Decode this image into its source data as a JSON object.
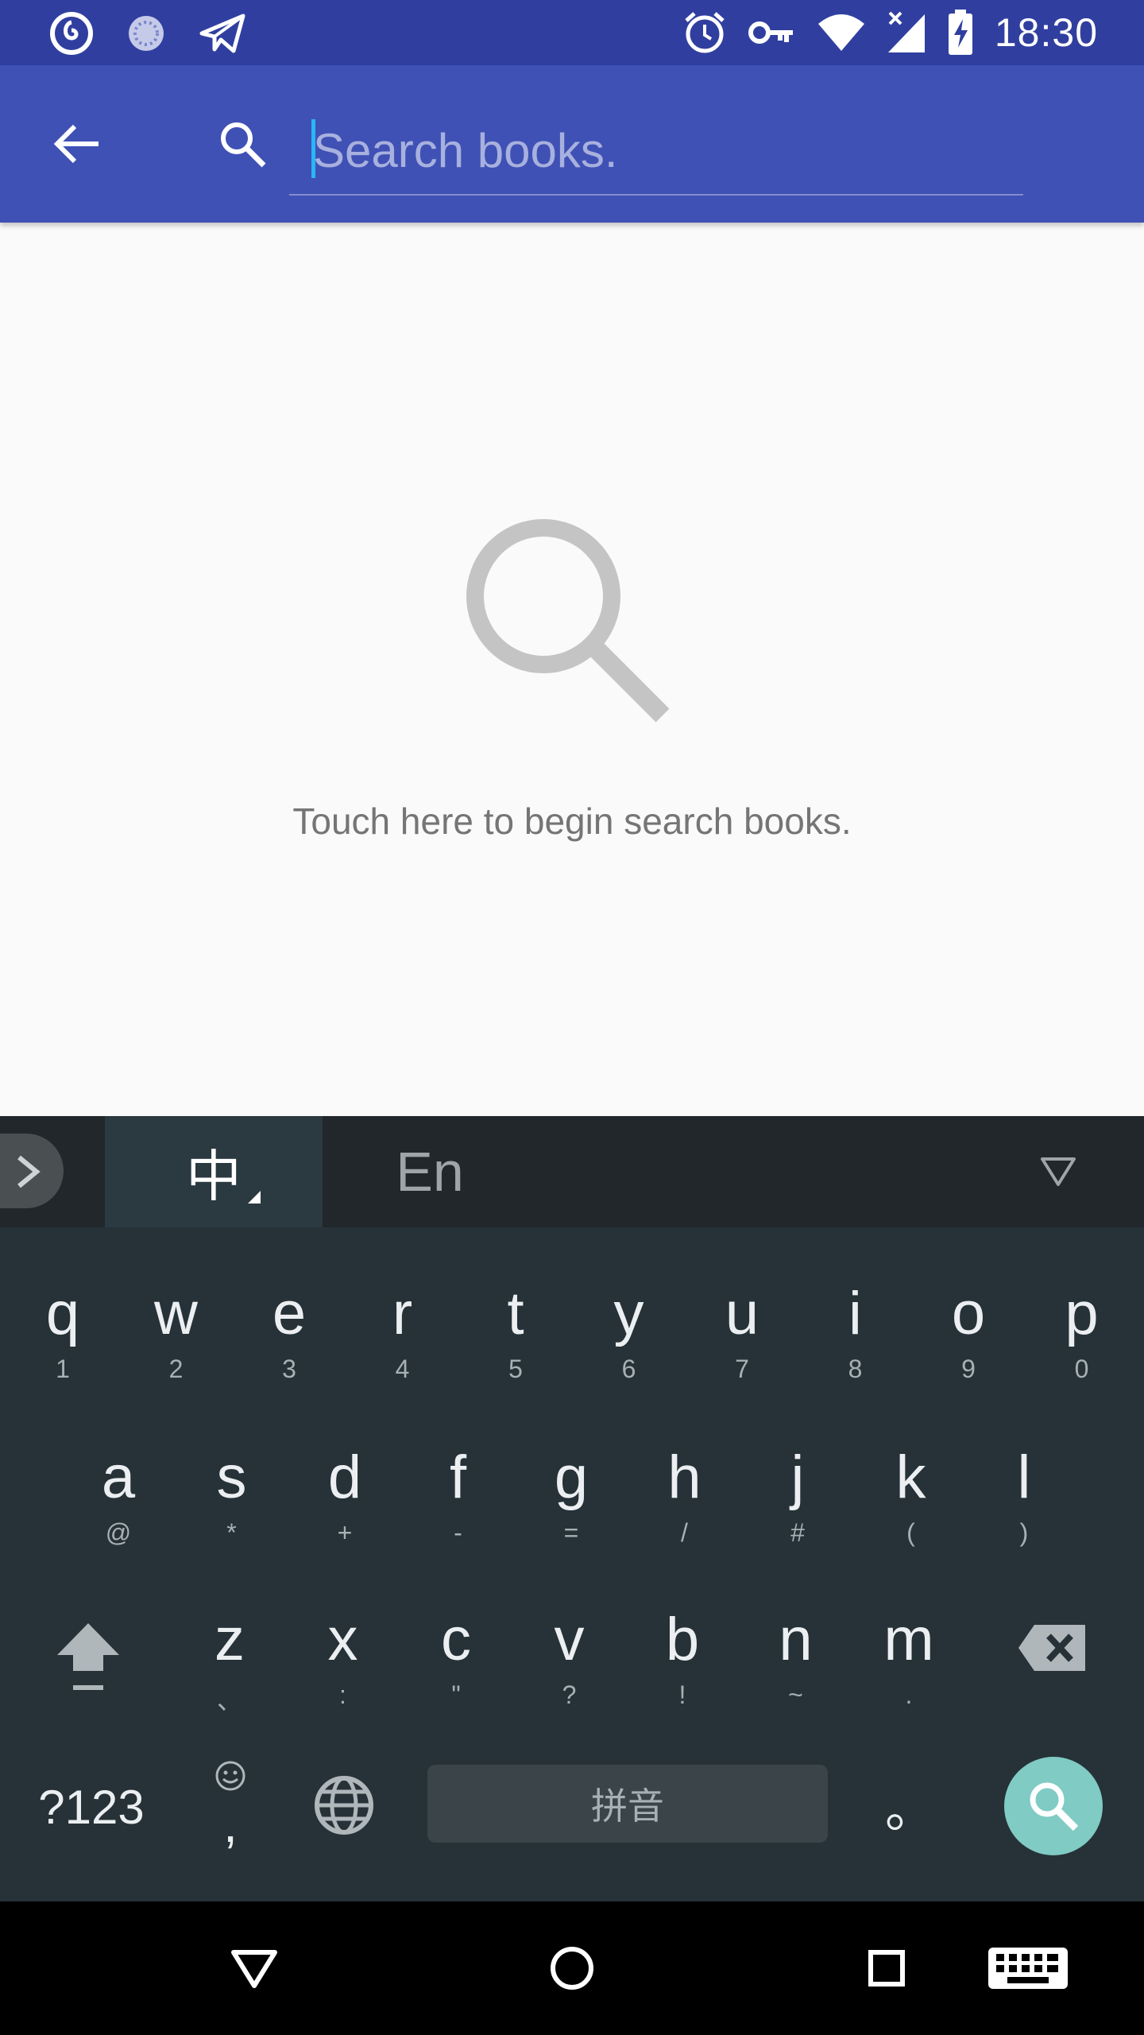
{
  "status_bar": {
    "time": "18:30",
    "left_icons": [
      "netease-music-icon",
      "loading-icon",
      "telegram-icon"
    ],
    "right_icons": [
      "alarm-icon",
      "vpn-key-icon",
      "wifi-icon",
      "signal-icon",
      "battery-charging-icon"
    ]
  },
  "app_bar": {
    "back_icon": "arrow-back-icon",
    "search_icon": "search-icon",
    "search_placeholder": "Search books.",
    "search_value": "",
    "background": "#3f51b5",
    "status_background": "#303f9f"
  },
  "empty_state": {
    "icon": "search-large-icon",
    "text": "Touch here to begin search books."
  },
  "keyboard": {
    "lang_selected": "中",
    "lang_other": "En",
    "rows": [
      [
        {
          "main": "q",
          "hint": "1"
        },
        {
          "main": "w",
          "hint": "2"
        },
        {
          "main": "e",
          "hint": "3"
        },
        {
          "main": "r",
          "hint": "4"
        },
        {
          "main": "t",
          "hint": "5"
        },
        {
          "main": "y",
          "hint": "6"
        },
        {
          "main": "u",
          "hint": "7"
        },
        {
          "main": "i",
          "hint": "8"
        },
        {
          "main": "o",
          "hint": "9"
        },
        {
          "main": "p",
          "hint": "0"
        }
      ],
      [
        {
          "main": "a",
          "hint": "@"
        },
        {
          "main": "s",
          "hint": "*"
        },
        {
          "main": "d",
          "hint": "+"
        },
        {
          "main": "f",
          "hint": "-"
        },
        {
          "main": "g",
          "hint": "="
        },
        {
          "main": "h",
          "hint": "/"
        },
        {
          "main": "j",
          "hint": "#"
        },
        {
          "main": "k",
          "hint": "("
        },
        {
          "main": "l",
          "hint": ")"
        }
      ],
      [
        {
          "main": "z",
          "hint": "、"
        },
        {
          "main": "x",
          "hint": ":"
        },
        {
          "main": "c",
          "hint": "\""
        },
        {
          "main": "v",
          "hint": "?"
        },
        {
          "main": "b",
          "hint": "!"
        },
        {
          "main": "n",
          "hint": "~"
        },
        {
          "main": "m",
          "hint": "."
        }
      ]
    ],
    "symbols_label": "?123",
    "comma_label": ",",
    "space_label": "拼音",
    "period_label": "。",
    "enter_icon": "search-icon",
    "enter_color": "#80cbc4"
  },
  "nav_bar": {
    "icons": [
      "back-triangle-icon",
      "home-circle-icon",
      "recents-square-icon",
      "keyboard-icon"
    ]
  }
}
